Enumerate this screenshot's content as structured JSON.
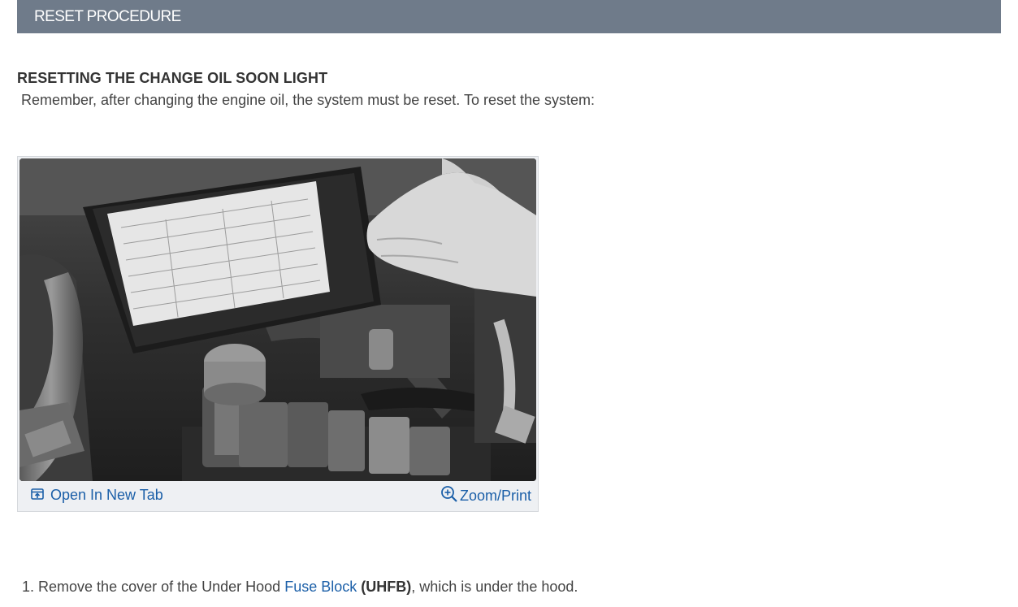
{
  "header": {
    "title": "RESET PROCEDURE"
  },
  "content": {
    "subheading": "RESETTING THE CHANGE OIL SOON LIGHT",
    "intro": "Remember, after changing the engine oil, the system must be reset. To reset the system:"
  },
  "figure": {
    "open_label": "Open In New Tab",
    "zoom_label": "Zoom/Print",
    "icons": [
      "open-new-tab-icon",
      "zoom-in-icon"
    ]
  },
  "steps": [
    {
      "number": "1.",
      "prefix": "Remove the cover of the Under Hood",
      "link": "Fuse Block",
      "bold": "(UHFB)",
      "suffix": ", which is under the hood."
    }
  ],
  "colors": {
    "header_bg": "#6f7b8a",
    "link": "#1b5fa8",
    "text": "#444444"
  }
}
